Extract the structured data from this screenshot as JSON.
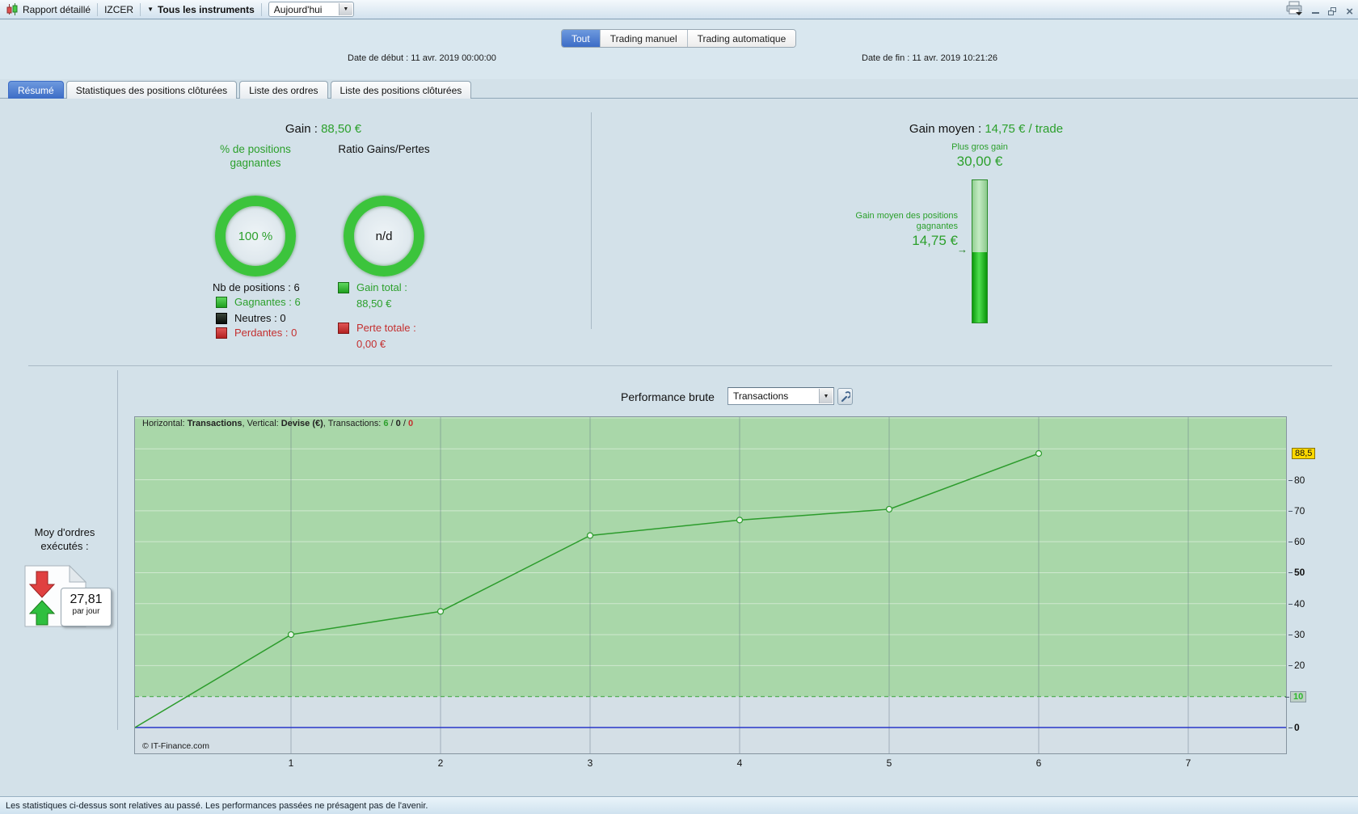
{
  "colors": {
    "accent_blue": "#3c6cc6",
    "positive_green": "#2ca02c",
    "negative_red": "#c42f2f",
    "chart_area_green": "#a9d7a9",
    "highlight_yellow": "#ffd900"
  },
  "toolbar": {
    "report": "Rapport détaillé",
    "instrument_code": "IZCER",
    "instruments": "Tous les instruments",
    "period": "Aujourd'hui"
  },
  "window_controls": {
    "minimize": "–",
    "close": "×"
  },
  "header": {
    "segments": [
      {
        "label": "Tout",
        "active": true
      },
      {
        "label": "Trading manuel",
        "active": false
      },
      {
        "label": "Trading automatique",
        "active": false
      }
    ],
    "date_start_label": "Date de début : ",
    "date_start_value": "11 avr. 2019 00:00:00",
    "date_end_label": "Date de fin : ",
    "date_end_value": "11 avr. 2019 10:21:26"
  },
  "tabs": [
    {
      "label": "Résumé",
      "active": true
    },
    {
      "label": "Statistiques des positions clôturées",
      "active": false
    },
    {
      "label": "Liste des ordres",
      "active": false
    },
    {
      "label": "Liste des positions clôturées",
      "active": false
    }
  ],
  "summary": {
    "gain_label": "Gain : ",
    "gain_value": "88,50 €",
    "winners_pct_title": "% de positions gagnantes",
    "winners_pct_value": "100 %",
    "ratio_title": "Ratio Gains/Pertes",
    "ratio_value": "n/d",
    "positions_label": "Nb de positions : 6",
    "winning_label": "Gagnantes : 6",
    "neutral_label": "Neutres : 0",
    "losing_label": "Perdantes : 0",
    "gain_total_label": "Gain total :",
    "gain_total_value": "88,50 €",
    "loss_total_label": "Perte totale :",
    "loss_total_value": "0,00 €"
  },
  "gain_panel": {
    "avg_gain_label": "Gain moyen : ",
    "avg_gain_value": "14,75 € / trade",
    "biggest_gain_label": "Plus gros gain",
    "biggest_gain_value": "30,00 €",
    "avg_win_label": "Gain moyen des positions gagnantes",
    "avg_win_value": "14,75 €",
    "arrow": "→",
    "bar": {
      "max": 30,
      "value": 14.75
    }
  },
  "orders_avg": {
    "label": "Moy d'ordres exécutés :",
    "value": "27,81",
    "unit": "par jour"
  },
  "performance": {
    "title": "Performance brute",
    "selector": "Transactions"
  },
  "chart_data": {
    "type": "line",
    "title": "Performance brute",
    "xlabel": "Transactions",
    "ylabel": "Devise (€)",
    "info_bar": {
      "horizontal_label": "Horizontal: ",
      "horizontal_value": "Transactions",
      "sep1": ", Vertical: ",
      "vertical_value": "Devise (€)",
      "sep2": ", Transactions: ",
      "wins": "6",
      "sep3": " / ",
      "neutrals": "0",
      "sep4": " / ",
      "losses": "0"
    },
    "x": [
      0,
      1,
      2,
      3,
      4,
      5,
      6
    ],
    "values": [
      0,
      30,
      37.5,
      62,
      67,
      70.5,
      88.5
    ],
    "x_ticks": [
      1,
      2,
      3,
      4,
      5,
      6,
      7
    ],
    "y_ticks": [
      {
        "value": 88.5,
        "label": "88,5",
        "tag": "yellow"
      },
      {
        "value": 80,
        "label": "80"
      },
      {
        "value": 70,
        "label": "70"
      },
      {
        "value": 60,
        "label": "60"
      },
      {
        "value": 50,
        "label": "50",
        "bold": true
      },
      {
        "value": 40,
        "label": "40"
      },
      {
        "value": 30,
        "label": "30"
      },
      {
        "value": 20,
        "label": "20"
      },
      {
        "value": 10,
        "label": "10",
        "tag": "green"
      },
      {
        "value": 0,
        "label": "0",
        "bold": true
      }
    ],
    "ylim": [
      0,
      100
    ],
    "dashed_line_value": 10,
    "zero_line_value": 0,
    "grid": true,
    "area_color": "#a9d7a9",
    "line_color": "#2c9c2c"
  },
  "footer": "Les statistiques ci-dessus sont relatives au passé. Les performances passées ne présagent pas de l'avenir.",
  "copyright": "© IT-Finance.com"
}
